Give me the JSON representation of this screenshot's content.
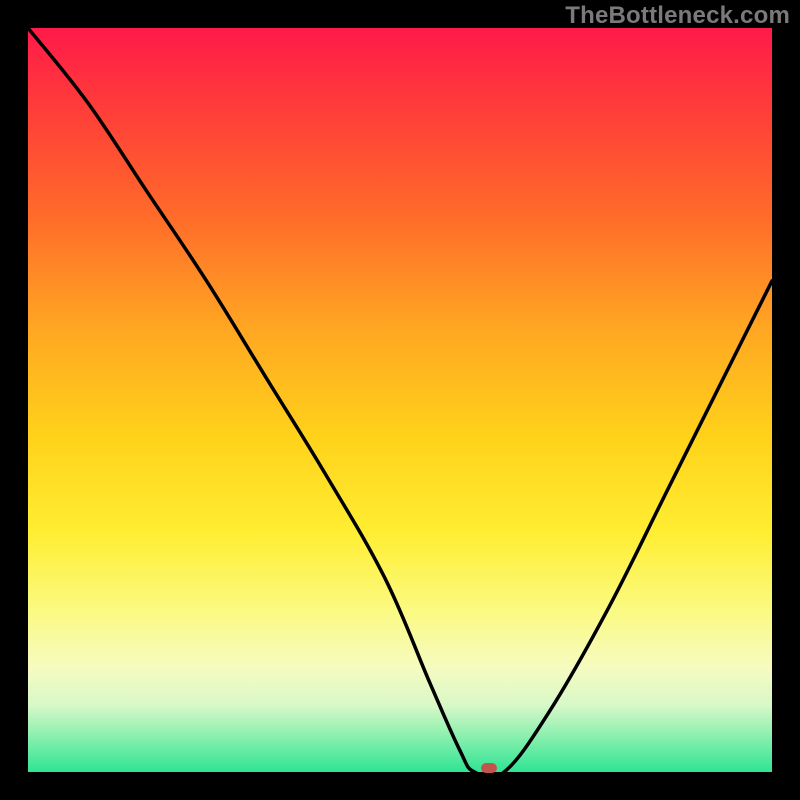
{
  "watermark": "TheBottleneck.com",
  "chart_data": {
    "type": "line",
    "title": "",
    "xlabel": "",
    "ylabel": "",
    "xlim": [
      0,
      100
    ],
    "ylim": [
      0,
      100
    ],
    "grid": false,
    "legend": false,
    "series": [
      {
        "name": "curve",
        "x": [
          0,
          8,
          16,
          24,
          32,
          40,
          48,
          54,
          58,
          60,
          64,
          70,
          78,
          86,
          94,
          100
        ],
        "y": [
          100,
          90,
          78,
          66,
          53,
          40,
          26,
          12,
          3,
          0,
          0,
          8,
          22,
          38,
          54,
          66
        ]
      }
    ],
    "min_point": {
      "x": 62,
      "y": 0
    },
    "colors": {
      "curve": "#000000",
      "marker": "#c1554e",
      "gradient_top": "#ff1a4a",
      "gradient_bottom": "#2fe493",
      "frame": "#000000"
    }
  }
}
